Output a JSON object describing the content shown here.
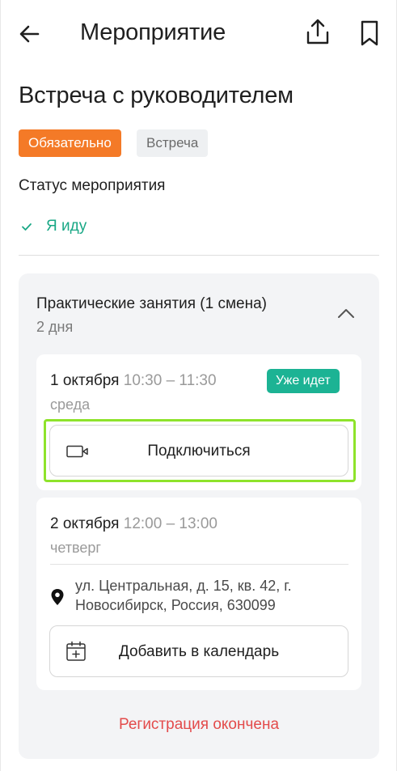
{
  "header": {
    "title": "Мероприятие",
    "back_icon": "arrow-left-icon",
    "share_icon": "share-icon",
    "bookmark_icon": "bookmark-icon"
  },
  "event": {
    "title": "Встреча с руководителем",
    "tags": [
      "Обязательно",
      "Встреча"
    ],
    "status_label": "Статус мероприятия",
    "status_value": "Я иду"
  },
  "session": {
    "title": "Практические занятия (1 смена)",
    "duration": "2 дня",
    "days": [
      {
        "date": "1 октября",
        "time": "10:30 – 11:30",
        "weekday": "среда",
        "badge": "Уже идет",
        "action_label": "Подключиться"
      },
      {
        "date": "2 октября",
        "time": "12:00 – 13:00",
        "weekday": "четверг",
        "address": "ул. Центральная, д. 15, кв. 42, г. Новосибирск, Россия, 630099",
        "action_label": "Добавить в календарь"
      }
    ],
    "registration_status": "Регистрация окончена"
  },
  "colors": {
    "accent_orange": "#f47a27",
    "accent_green": "#1cb394",
    "status_green": "#1aa886",
    "danger_red": "#e34b4b",
    "highlight": "#8ee32b"
  }
}
